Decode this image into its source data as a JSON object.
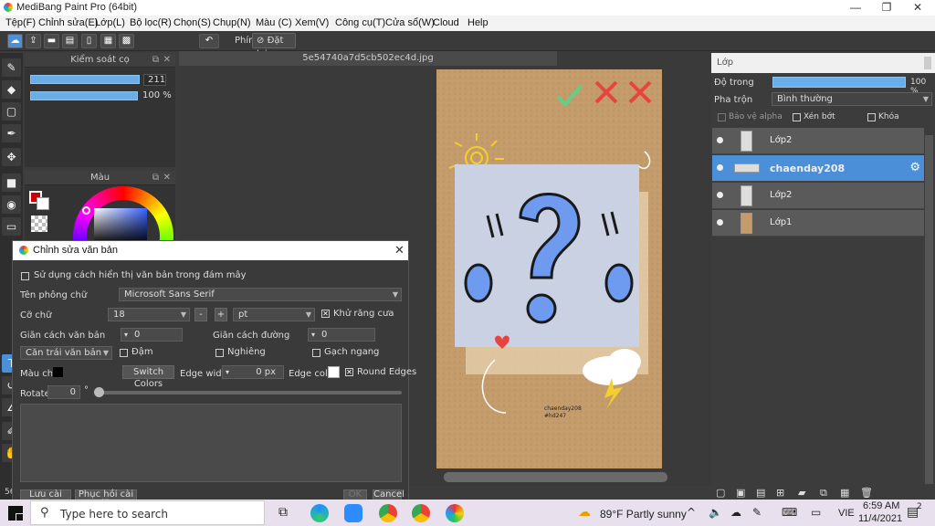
{
  "window": {
    "title": "MediBang Paint Pro (64bit)"
  },
  "menu": [
    "Tệp(F)",
    "Chỉnh sửa(E)",
    "Lớp(L)",
    "Bộ lọc(R)",
    "Chọn(S)",
    "Chụp(N)",
    "Màu (C)",
    "Xem(V)",
    "Công cụ(T)",
    "Cửa sổ(W)",
    "Cloud",
    "Help"
  ],
  "toolbar": {
    "key_label": "Phím",
    "reset_label": "Đặt lại"
  },
  "brush_panel": {
    "title": "Kiểm soát cọ",
    "size_value": "211",
    "opacity_value": "100 %"
  },
  "color_panel": {
    "title": "Màu"
  },
  "document": {
    "tab": "5e54740a7d5cb502ec4d.jpg",
    "caption_line1": "chaenday208",
    "caption_line2": "#hd247"
  },
  "layers": {
    "title": "Lớp",
    "opacity_label": "Độ trong",
    "opacity_value": "100 %",
    "blend_label": "Pha trộn",
    "blend_value": "Bình thường",
    "protect_alpha": "Bảo vệ alpha",
    "clipping": "Xén bớt",
    "lock": "Khóa",
    "items": [
      {
        "name": "Lớp2",
        "selected": false
      },
      {
        "name": "chaenday208",
        "selected": true
      },
      {
        "name": "Lớp2",
        "selected": false
      },
      {
        "name": "Lớp1",
        "selected": false
      }
    ]
  },
  "dialog": {
    "title": "Chỉnh sửa văn bản",
    "cloud_render": "Sử dụng cách hiển thị văn bản trong đám mây",
    "font_label": "Tên phông chữ",
    "font_value": "Microsoft Sans Serif",
    "size_label": "Cỡ chữ",
    "size_value": "18",
    "minus": "-",
    "plus": "+",
    "unit_value": "pt",
    "antialias": "Khử răng cưa",
    "char_spacing_label": "Giãn cách văn bản",
    "char_spacing_value": "0",
    "line_spacing_label": "Giãn cách đường",
    "line_spacing_value": "0",
    "align_value": "Căn trái văn bản",
    "bold": "Đậm",
    "italic": "Nghiêng",
    "strike": "Gạch ngang",
    "text_color_label": "Màu chữ",
    "switch_colors": "Switch Colors",
    "edge_width_label": "Edge width",
    "edge_width_value": "0 px",
    "edge_color_label": "Edge color",
    "round_edges": "Round Edges",
    "rotate_label": "Rotate",
    "rotate_value": "0",
    "rotate_unit": "°",
    "save_settings": "Lưu cài đặt",
    "restore_settings": "Phục hồi cài đặt",
    "ok": "OK",
    "cancel": "Cancel"
  },
  "left_strip": {
    "bottom_number": "56"
  },
  "taskbar": {
    "search_placeholder": "Type here to search",
    "weather": "89°F  Partly sunny",
    "language": "VIE",
    "time": "6:59 AM",
    "date": "11/4/2021",
    "notification_count": "2"
  },
  "colors": {
    "accent": "#4a8fd8",
    "foreground_color": "#cc0000"
  }
}
